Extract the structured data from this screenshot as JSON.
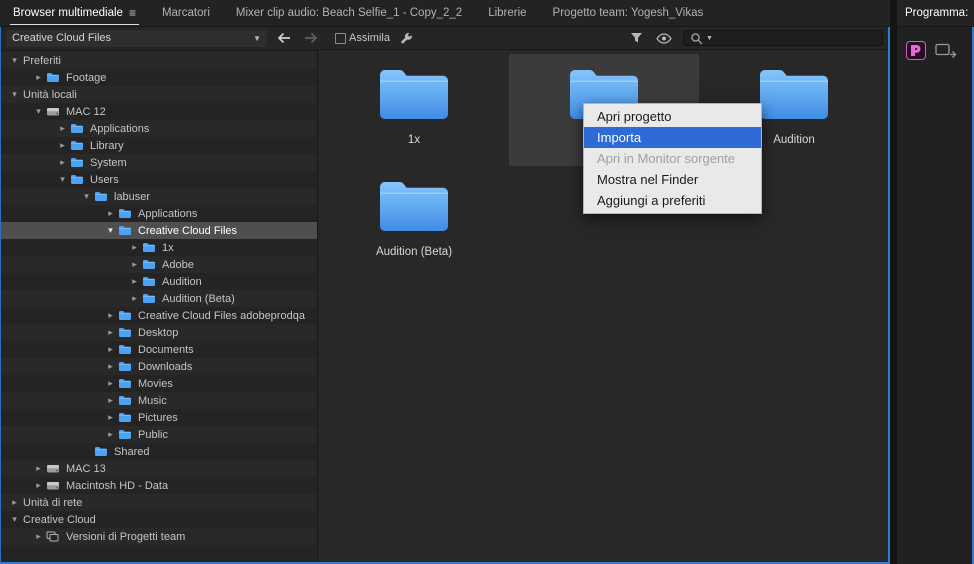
{
  "panel_tabs": [
    {
      "label": "Browser multimediale",
      "active": true
    },
    {
      "label": "Marcatori",
      "active": false
    },
    {
      "label": "Mixer clip audio: Beach Selfie_1 - Copy_2_2",
      "active": false
    },
    {
      "label": "Librerie",
      "active": false
    },
    {
      "label": "Progetto team: Yogesh_Vikas",
      "active": false
    }
  ],
  "program_panel": {
    "tab_label": "Programma:"
  },
  "toolbar": {
    "location_dropdown_value": "Creative Cloud Files",
    "ingest_checkbox_label": "Assimila",
    "search_value": ""
  },
  "directory_tree": [
    {
      "label": "Preferiti",
      "level": 0,
      "arrow": "open",
      "icon": "none",
      "selected": false
    },
    {
      "label": "Footage",
      "level": 1,
      "arrow": "closed",
      "icon": "folder",
      "selected": false
    },
    {
      "label": "Unità locali",
      "level": 0,
      "arrow": "open",
      "icon": "none",
      "selected": false
    },
    {
      "label": "MAC 12",
      "level": 1,
      "arrow": "open",
      "icon": "disk",
      "selected": false
    },
    {
      "label": "Applications",
      "level": 2,
      "arrow": "closed",
      "icon": "folder",
      "selected": false
    },
    {
      "label": "Library",
      "level": 2,
      "arrow": "closed",
      "icon": "folder",
      "selected": false
    },
    {
      "label": "System",
      "level": 2,
      "arrow": "closed",
      "icon": "folder",
      "selected": false
    },
    {
      "label": "Users",
      "level": 2,
      "arrow": "open",
      "icon": "folder",
      "selected": false
    },
    {
      "label": "labuser",
      "level": 3,
      "arrow": "open",
      "icon": "folder",
      "selected": false
    },
    {
      "label": "Applications",
      "level": 4,
      "arrow": "closed",
      "icon": "folder",
      "selected": false
    },
    {
      "label": "Creative Cloud Files",
      "level": 4,
      "arrow": "open",
      "icon": "folder",
      "selected": true
    },
    {
      "label": "1x",
      "level": 5,
      "arrow": "closed",
      "icon": "folder",
      "selected": false
    },
    {
      "label": "Adobe",
      "level": 5,
      "arrow": "closed",
      "icon": "folder",
      "selected": false
    },
    {
      "label": "Audition",
      "level": 5,
      "arrow": "closed",
      "icon": "folder",
      "selected": false
    },
    {
      "label": "Audition (Beta)",
      "level": 5,
      "arrow": "closed",
      "icon": "folder",
      "selected": false
    },
    {
      "label": "Creative Cloud Files adobeprodqa",
      "level": 4,
      "arrow": "closed",
      "icon": "folder",
      "selected": false
    },
    {
      "label": "Desktop",
      "level": 4,
      "arrow": "closed",
      "icon": "folder",
      "selected": false
    },
    {
      "label": "Documents",
      "level": 4,
      "arrow": "closed",
      "icon": "folder",
      "selected": false
    },
    {
      "label": "Downloads",
      "level": 4,
      "arrow": "closed",
      "icon": "folder",
      "selected": false
    },
    {
      "label": "Movies",
      "level": 4,
      "arrow": "closed",
      "icon": "folder",
      "selected": false
    },
    {
      "label": "Music",
      "level": 4,
      "arrow": "closed",
      "icon": "folder",
      "selected": false
    },
    {
      "label": "Pictures",
      "level": 4,
      "arrow": "closed",
      "icon": "folder",
      "selected": false
    },
    {
      "label": "Public",
      "level": 4,
      "arrow": "closed",
      "icon": "folder",
      "selected": false
    },
    {
      "label": "Shared",
      "level": 3,
      "arrow": "none",
      "icon": "folder",
      "selected": false
    },
    {
      "label": "MAC 13",
      "level": 1,
      "arrow": "closed",
      "icon": "disk",
      "selected": false
    },
    {
      "label": "Macintosh HD - Data",
      "level": 1,
      "arrow": "closed",
      "icon": "disk",
      "selected": false
    },
    {
      "label": "Unità di rete",
      "level": 0,
      "arrow": "closed",
      "icon": "none",
      "selected": false
    },
    {
      "label": "Creative Cloud",
      "level": 0,
      "arrow": "open",
      "icon": "none",
      "selected": false
    },
    {
      "label": "Versioni di Progetti team",
      "level": 1,
      "arrow": "closed",
      "icon": "team",
      "selected": false
    }
  ],
  "content_grid": {
    "tiles": [
      {
        "label": "1x",
        "selected": false
      },
      {
        "label": "",
        "selected": true
      },
      {
        "label": "Audition",
        "selected": false
      },
      {
        "label": "Audition (Beta)",
        "selected": false
      }
    ]
  },
  "context_menu": {
    "items": [
      {
        "label": "Apri progetto",
        "highlighted": false,
        "disabled": false
      },
      {
        "label": "Importa",
        "highlighted": true,
        "disabled": false
      },
      {
        "label": "Apri in Monitor sorgente",
        "highlighted": false,
        "disabled": true
      },
      {
        "label": "Mostra nel Finder",
        "highlighted": false,
        "disabled": false
      },
      {
        "label": "Aggiungi a preferiti",
        "highlighted": false,
        "disabled": false
      }
    ]
  },
  "colors": {
    "menu_highlight": "#2e6bd4",
    "folder_blue": "#4a99ec",
    "focus_border": "#2f7bd8",
    "selection_gray": "#4f4f4f"
  }
}
